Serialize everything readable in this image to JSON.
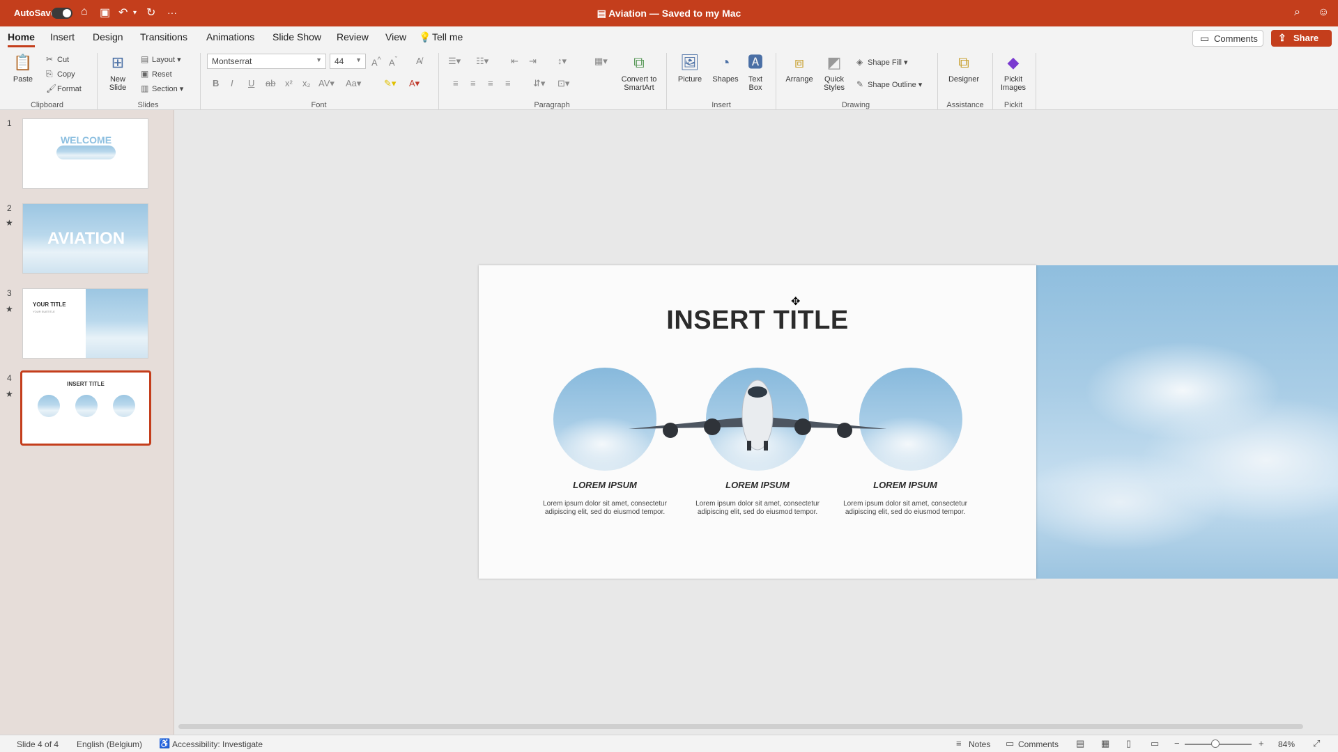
{
  "window": {
    "autosave_label": "AutoSave",
    "title": "Aviation — Saved to my Mac",
    "title_chevron": "⌄",
    "more": "···"
  },
  "tabs": [
    {
      "label": "Home"
    },
    {
      "label": "Insert"
    },
    {
      "label": "Design"
    },
    {
      "label": "Transitions"
    },
    {
      "label": "Animations"
    },
    {
      "label": "Slide Show"
    },
    {
      "label": "Review"
    },
    {
      "label": "View"
    },
    {
      "label": "Tell me"
    }
  ],
  "header_buttons": {
    "comments": "Comments",
    "share": "Share"
  },
  "ribbon": {
    "clipboard": {
      "paste": "Paste",
      "cut": "Cut",
      "copy": "Copy",
      "format": "Format",
      "group": "Clipboard"
    },
    "slides": {
      "new_slide_1": "New",
      "new_slide_2": "Slide",
      "layout": "Layout",
      "reset": "Reset",
      "section": "Section",
      "group": "Slides"
    },
    "font": {
      "family": "Montserrat",
      "size": "44",
      "group": "Font"
    },
    "paragraph": {
      "smartart_1": "Convert to",
      "smartart_2": "SmartArt",
      "group": "Paragraph"
    },
    "insert": {
      "picture": "Picture",
      "shapes": "Shapes",
      "textbox_1": "Text",
      "textbox_2": "Box",
      "group": "Insert"
    },
    "drawing": {
      "arrange": "Arrange",
      "quick_1": "Quick",
      "quick_2": "Styles",
      "shape_fill": "Shape Fill",
      "shape_outline": "Shape Outline",
      "group": "Drawing"
    },
    "assistance": {
      "designer": "Designer",
      "group": "Assistance"
    },
    "pickit": {
      "label_1": "Pickit",
      "label_2": "Images",
      "group": "Pickit"
    }
  },
  "thumbnails": [
    {
      "num": "1",
      "text": "WELCOME"
    },
    {
      "num": "2",
      "text": "AVIATION"
    },
    {
      "num": "3",
      "text": "YOUR TITLE",
      "sub": "YOUR SUBTITLE"
    },
    {
      "num": "4",
      "text": "INSERT TITLE"
    }
  ],
  "slide": {
    "title": "INSERT TITLE",
    "columns": [
      {
        "heading": "LOREM IPSUM",
        "body": "Lorem ipsum dolor sit amet, consectetur adipiscing elit, sed do eiusmod tempor."
      },
      {
        "heading": "LOREM IPSUM",
        "body": "Lorem ipsum dolor sit amet, consectetur adipiscing elit, sed do eiusmod tempor."
      },
      {
        "heading": "LOREM IPSUM",
        "body": "Lorem ipsum dolor sit amet, consectetur adipiscing elit, sed do eiusmod tempor."
      }
    ]
  },
  "status": {
    "slide_count": "Slide 4 of 4",
    "language": "English (Belgium)",
    "accessibility": "Accessibility: Investigate",
    "notes": "Notes",
    "comments": "Comments",
    "zoom": "84%"
  },
  "colors": {
    "accent": "#c43e1c",
    "panel": "#e6ddd9"
  }
}
